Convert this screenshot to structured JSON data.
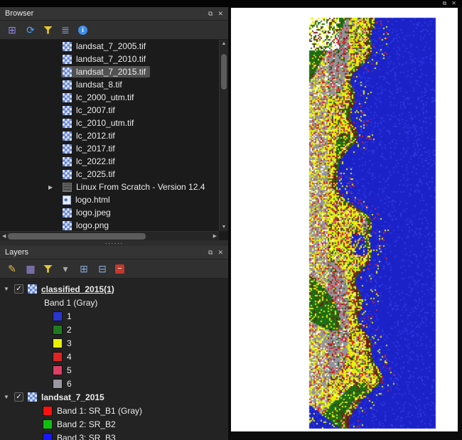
{
  "chrome": {
    "float_glyph": "⧉",
    "close_glyph": "✕",
    "check_glyph": "✓",
    "collapse_glyph": "▼",
    "expand_glyph": "▶",
    "up_glyph": "▲",
    "down_glyph": "▼",
    "left_glyph": "◀",
    "right_glyph": "▶",
    "splitter_dots": "······"
  },
  "browser": {
    "title": "Browser",
    "toolbar": [
      {
        "name": "add-selected-layers",
        "kind": "glyph",
        "glyph": "⊞",
        "color": "#8f86e0"
      },
      {
        "name": "refresh",
        "kind": "glyph",
        "glyph": "⟳",
        "color": "#4aa3ff"
      },
      {
        "name": "filter-browser",
        "kind": "funnel",
        "color": "#e6c832"
      },
      {
        "name": "collapse-all",
        "kind": "glyph",
        "glyph": "≣",
        "color": "#86a8d8"
      },
      {
        "name": "properties-info",
        "kind": "info",
        "color": "#3f8fe8"
      }
    ],
    "items": [
      {
        "label": "landsat_7_2005.tif",
        "icon": "raster"
      },
      {
        "label": "landsat_7_2010.tif",
        "icon": "raster"
      },
      {
        "label": "landsat_7_2015.tif",
        "icon": "raster",
        "selected": true
      },
      {
        "label": "landsat_8.tif",
        "icon": "raster"
      },
      {
        "label": "lc_2000_utm.tif",
        "icon": "raster"
      },
      {
        "label": "lc_2007.tif",
        "icon": "raster"
      },
      {
        "label": "lc_2010_utm.tif",
        "icon": "raster"
      },
      {
        "label": "lc_2012.tif",
        "icon": "raster"
      },
      {
        "label": "lc_2017.tif",
        "icon": "raster"
      },
      {
        "label": "lc_2022.tif",
        "icon": "raster"
      },
      {
        "label": "lc_2025.tif",
        "icon": "raster"
      },
      {
        "label": "Linux From Scratch - Version 12.4",
        "icon": "book",
        "expandable": true
      },
      {
        "label": "logo.html",
        "icon": "html"
      },
      {
        "label": "logo.jpeg",
        "icon": "raster"
      },
      {
        "label": "logo.png",
        "icon": "raster"
      }
    ]
  },
  "layers": {
    "title": "Layers",
    "toolbar": [
      {
        "name": "open-layer-styling",
        "kind": "glyph",
        "glyph": "✎",
        "color": "#e0b84a"
      },
      {
        "name": "manage-map-themes",
        "kind": "glyph",
        "glyph": "▦",
        "color": "#9f8fe8"
      },
      {
        "name": "filter-legend",
        "kind": "funnel",
        "color": "#e6c832"
      },
      {
        "name": "filter-dropdown",
        "kind": "glyph",
        "glyph": "▾",
        "color": "#aaaaaa"
      },
      {
        "name": "expand-all",
        "kind": "glyph",
        "glyph": "⊞",
        "color": "#86a8d8"
      },
      {
        "name": "collapse-all-layers",
        "kind": "glyph",
        "glyph": "⊟",
        "color": "#86a8d8"
      },
      {
        "name": "remove-layer",
        "kind": "remove",
        "color": "#c0392b"
      }
    ],
    "nodes": [
      {
        "kind": "layer",
        "label": "classified_2015(1)",
        "checked": true,
        "emphasized": true
      },
      {
        "kind": "text",
        "label": "Band 1 (Gray)",
        "indent": 62
      },
      {
        "kind": "swatch",
        "label": "1",
        "color": "#2a35cf",
        "indent": 74
      },
      {
        "kind": "swatch",
        "label": "2",
        "color": "#1f7a1f",
        "indent": 74
      },
      {
        "kind": "swatch",
        "label": "3",
        "color": "#e8f000",
        "indent": 74
      },
      {
        "kind": "swatch",
        "label": "4",
        "color": "#e02424",
        "indent": 74
      },
      {
        "kind": "swatch",
        "label": "5",
        "color": "#de3d66",
        "indent": 74
      },
      {
        "kind": "swatch",
        "label": "6",
        "color": "#9b98a2",
        "indent": 74
      },
      {
        "kind": "layer",
        "label": "landsat_7_2015",
        "checked": true
      },
      {
        "kind": "swatch",
        "label": "Band 1: SR_B1 (Gray)",
        "color": "#ff1010",
        "indent": 60
      },
      {
        "kind": "swatch",
        "label": "Band 2: SR_B2",
        "color": "#10c010",
        "indent": 60
      },
      {
        "kind": "swatch",
        "label": "Band 3: SR_B3",
        "color": "#1616ff",
        "indent": 60
      }
    ]
  },
  "map": {
    "background": "#ffffff",
    "palette": {
      "water": "#1b23c8",
      "water2": "#2c37e0",
      "yellow": "#e4f20a",
      "green": "#1d6e14",
      "gray": "#96929c",
      "red": "#e01f1f",
      "darkred": "#6e1d12",
      "magenta": "#c93a80",
      "white": "#ffffff"
    }
  }
}
